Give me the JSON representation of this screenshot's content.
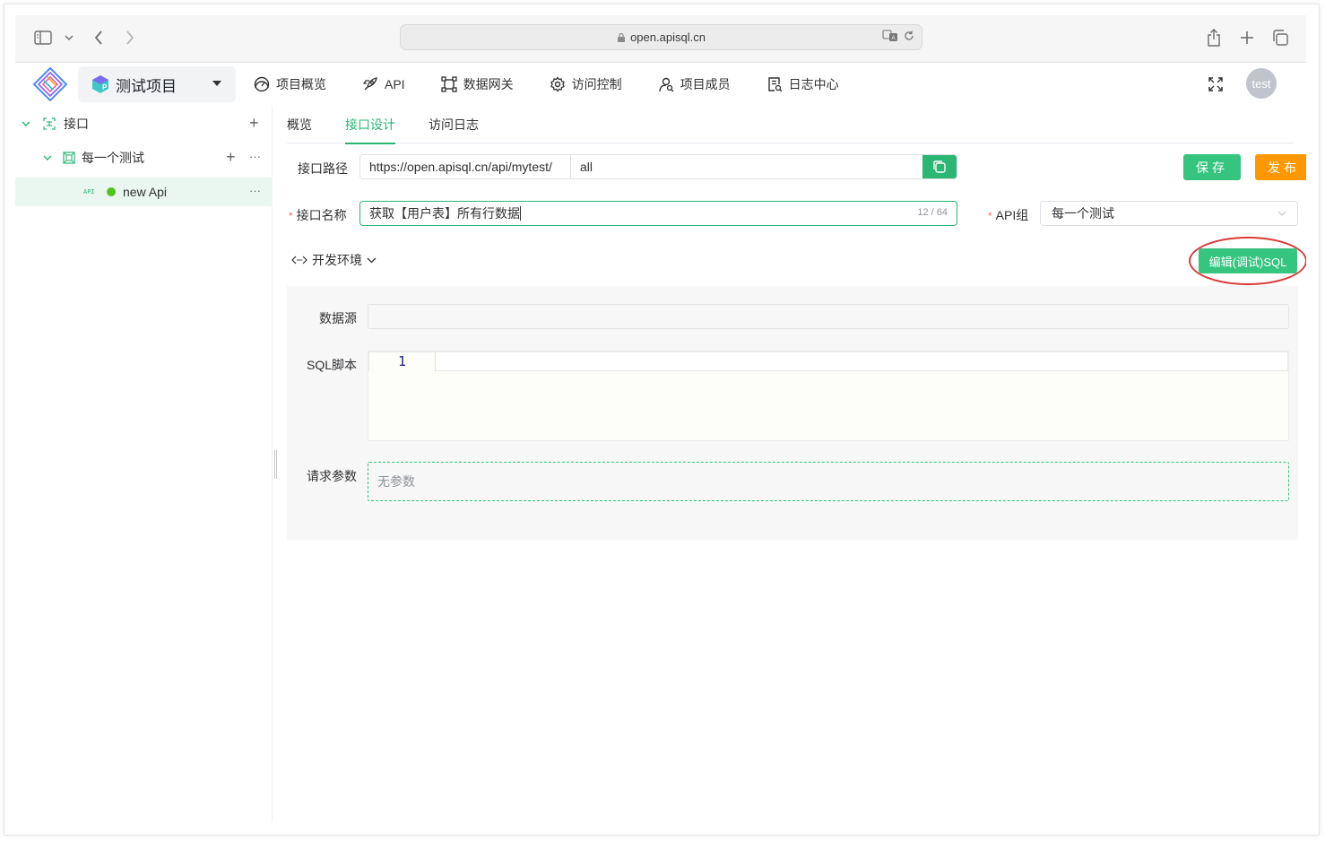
{
  "browser": {
    "url": "open.apisql.cn"
  },
  "header": {
    "project_name": "测试项目",
    "nav": [
      {
        "label": "项目概览",
        "icon": "dashboard-icon"
      },
      {
        "label": "API",
        "icon": "rocket-icon"
      },
      {
        "label": "数据网关",
        "icon": "gateway-icon"
      },
      {
        "label": "访问控制",
        "icon": "gear-icon"
      },
      {
        "label": "项目成员",
        "icon": "members-icon"
      },
      {
        "label": "日志中心",
        "icon": "log-icon"
      }
    ],
    "avatar_text": "test"
  },
  "sidebar": {
    "root_label": "接口",
    "group_label": "每一个测试",
    "api_tag": "API",
    "api_label": "new Api",
    "more": "···",
    "add": "+"
  },
  "tabs": [
    {
      "label": "概览",
      "active": false
    },
    {
      "label": "接口设计",
      "active": true
    },
    {
      "label": "访问日志",
      "active": false
    }
  ],
  "form": {
    "path_label": "接口路径",
    "path_prefix": "https://open.apisql.cn/api/mytest/",
    "path_value": "all",
    "save_label": "保存",
    "publish_label": "发布",
    "name_label": "接口名称",
    "name_value": "获取【用户表】所有行数据",
    "name_count": "12 / 64",
    "group_label": "API组",
    "group_value": "每一个测试",
    "required_mark": "*",
    "env_label": "开发环境",
    "edit_sql_label": "编辑(调试)SQL",
    "datasource_label": "数据源",
    "sql_label": "SQL脚本",
    "line_number": "1",
    "params_label": "请求参数",
    "params_empty": "无参数"
  },
  "colors": {
    "primary": "#2bb673",
    "button_green": "#35c57f",
    "publish_orange": "#ff9800",
    "highlight_ring": "#d83a3a"
  }
}
